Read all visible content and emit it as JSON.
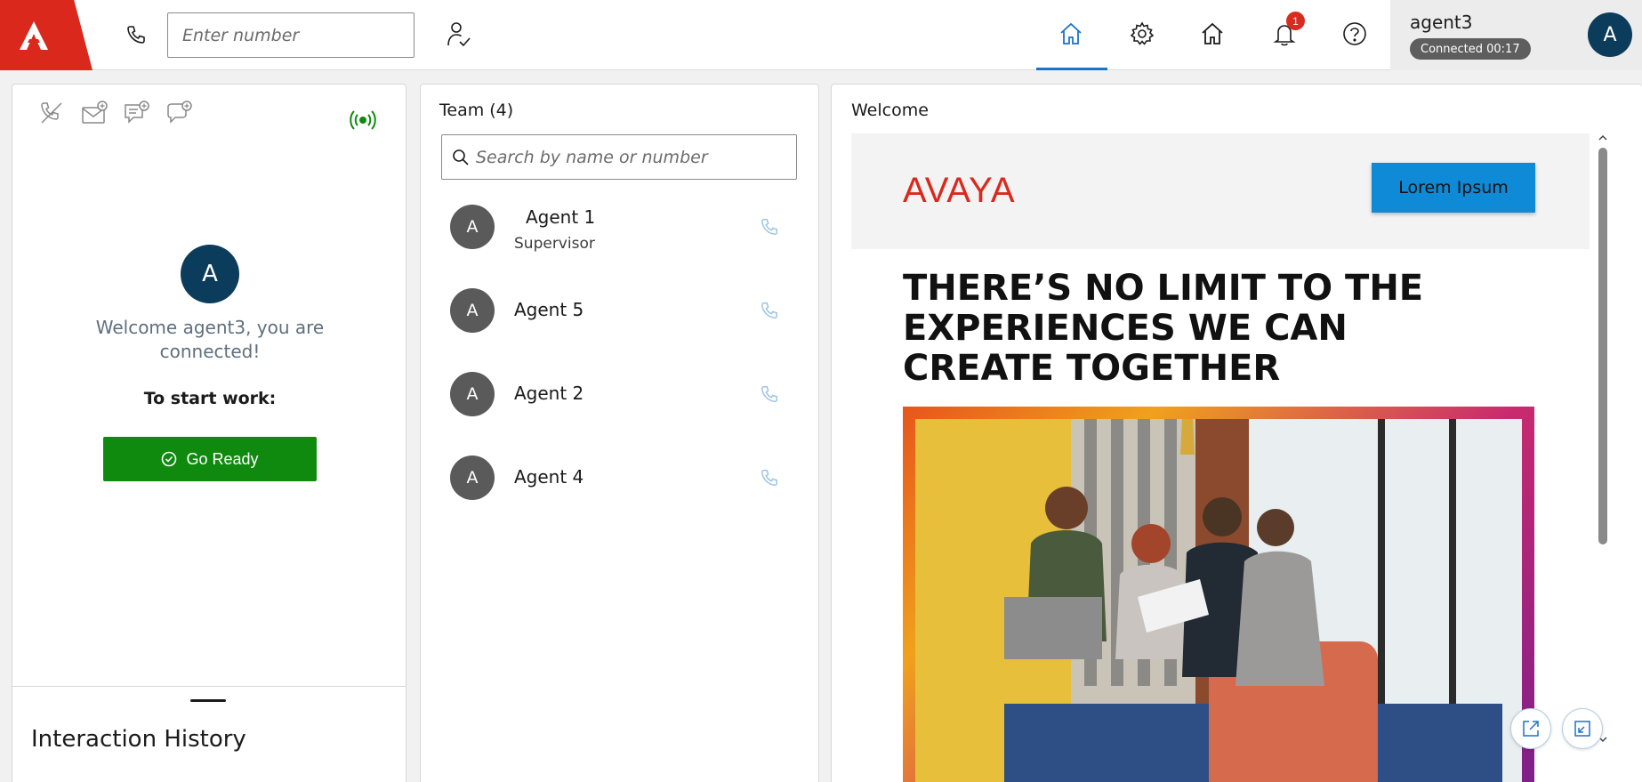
{
  "header": {
    "number_placeholder": "Enter number",
    "notification_count": "1",
    "user_name": "agent3",
    "connection_status": "Connected 00:17",
    "avatar_initial": "A"
  },
  "left_panel": {
    "avatar_initial": "A",
    "welcome_message": "Welcome agent3, you are connected!",
    "start_work_label": "To start work:",
    "go_ready_label": "Go Ready",
    "history_title": "Interaction History"
  },
  "team": {
    "title": "Team (4)",
    "search_placeholder": "Search by name or number",
    "members": [
      {
        "initial": "A",
        "name": "Agent 1",
        "role": "Supervisor"
      },
      {
        "initial": "A",
        "name": "Agent 5"
      },
      {
        "initial": "A",
        "name": "Agent 2"
      },
      {
        "initial": "A",
        "name": "Agent 4"
      }
    ]
  },
  "welcome": {
    "title": "Welcome",
    "brand": "AVAYA",
    "cta_label": "Lorem Ipsum",
    "headline_line1": "THERE’S NO LIMIT TO THE",
    "headline_line2": "EXPERIENCES WE CAN",
    "headline_line3": "CREATE TOGETHER"
  },
  "colors": {
    "brand_red": "#da291c",
    "ready_green": "#0f8a0f",
    "active_blue": "#1a73c8",
    "avatar_navy": "#0c3c5b",
    "cta_blue": "#0e8ad6"
  },
  "icons": {
    "dial": "phone-icon",
    "agent_state": "user-check-icon",
    "home": "home-icon",
    "settings": "gear-icon",
    "notifications": "bell-icon",
    "help": "help-icon",
    "presence": "signal-icon",
    "call": "phone-icon",
    "search": "search-icon",
    "popout": "popout-icon",
    "dock": "dock-icon"
  }
}
